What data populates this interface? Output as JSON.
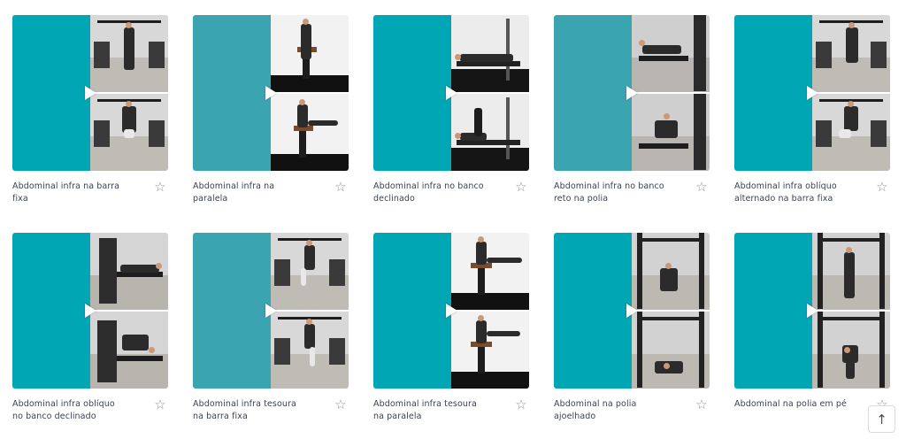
{
  "colors": {
    "panel_dark_teal": "#00a6b3",
    "panel_light_teal": "#3aa4b1",
    "title_text": "#3b4250",
    "star_icon": "#8e939c"
  },
  "exercises": [
    {
      "title": "Abdominal infra na barra fixa",
      "icon": "star-outline-icon",
      "panel": "#00a6b3"
    },
    {
      "title": "Abdominal infra na paralela",
      "icon": "star-outline-icon",
      "panel": "#3aa4b1"
    },
    {
      "title": "Abdominal infra no banco declinado",
      "icon": "star-outline-icon",
      "panel": "#00a6b3"
    },
    {
      "title": "Abdominal infra no banco reto na polia",
      "icon": "star-outline-icon",
      "panel": "#3aa4b1"
    },
    {
      "title": "Abdominal infra oblíquo alternado na barra fixa",
      "icon": "star-outline-icon",
      "panel": "#00a6b3"
    },
    {
      "title": "Abdominal infra oblíquo no banco declinado",
      "icon": "star-outline-icon",
      "panel": "#00a6b3"
    },
    {
      "title": "Abdominal infra tesoura na barra fixa",
      "icon": "star-outline-icon",
      "panel": "#3aa4b1"
    },
    {
      "title": "Abdominal infra tesoura na paralela",
      "icon": "star-outline-icon",
      "panel": "#00a6b3"
    },
    {
      "title": "Abdominal na polia ajoelhado",
      "icon": "star-outline-icon",
      "panel": "#00a6b3"
    },
    {
      "title": "Abdominal na polia em pé",
      "icon": "star-outline-icon",
      "panel": "#00a6b3"
    }
  ],
  "scroll_top": {
    "icon": "arrow-up-icon",
    "glyph": "↑"
  }
}
